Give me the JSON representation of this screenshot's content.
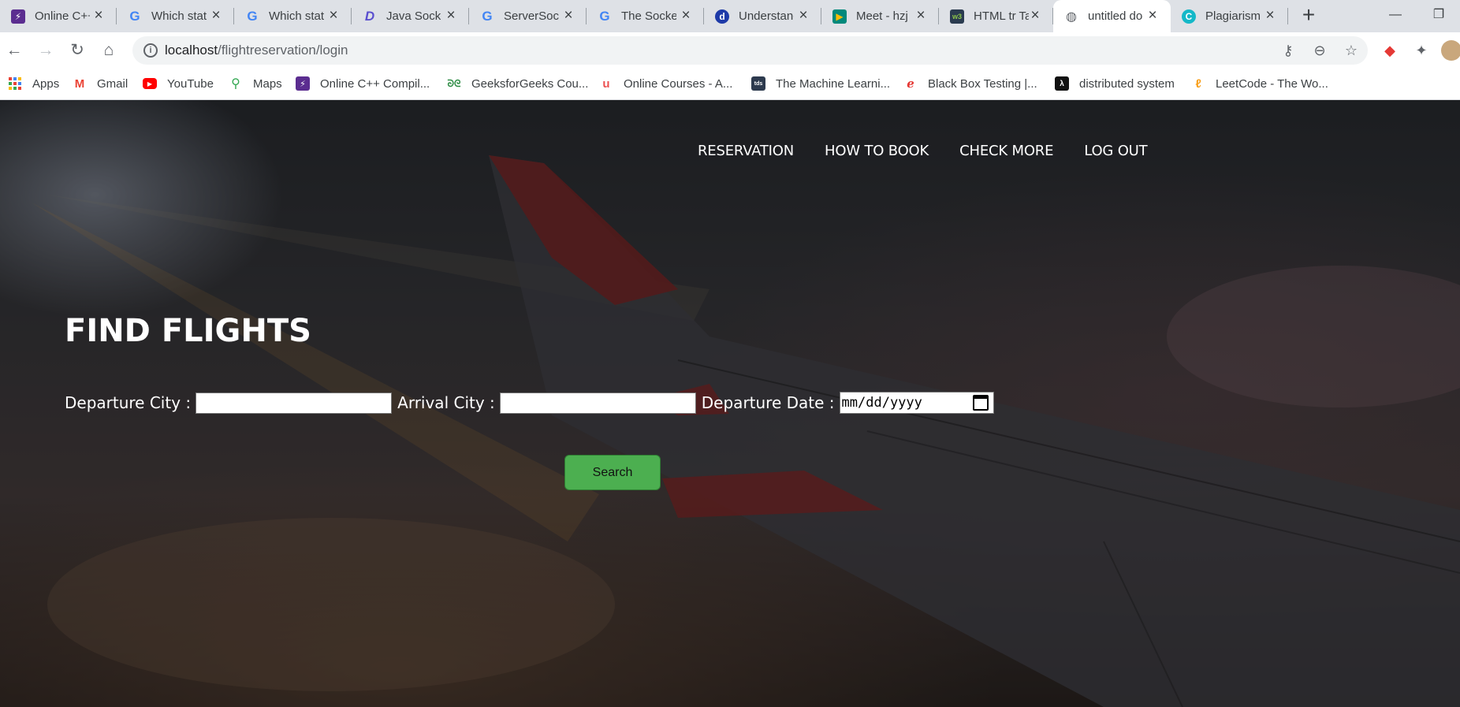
{
  "browser": {
    "tabs": [
      {
        "title": "Online C++",
        "favicon": "lightning-icon",
        "color": "#5b2d90"
      },
      {
        "title": "Which static",
        "favicon": "google-icon",
        "color": "#4285f4"
      },
      {
        "title": "Which static",
        "favicon": "google-icon",
        "color": "#4285f4"
      },
      {
        "title": "Java Socket",
        "favicon": "d-logo-icon",
        "color": "#5a4fcf"
      },
      {
        "title": "ServerSocket",
        "favicon": "google-icon",
        "color": "#4285f4"
      },
      {
        "title": "The Socket",
        "favicon": "google-icon",
        "color": "#4285f4"
      },
      {
        "title": "Understanding",
        "favicon": "d-circle-icon",
        "color": "#1e3aa8"
      },
      {
        "title": "Meet - hzj",
        "favicon": "meet-icon",
        "color": "#00897b"
      },
      {
        "title": "HTML tr Tag",
        "favicon": "w3-icon",
        "color": "#2a3b4f"
      },
      {
        "title": "untitled document",
        "favicon": "globe-icon",
        "color": "#5f6368"
      },
      {
        "title": "Plagiarism",
        "favicon": "c-logo-icon",
        "color": "#14b8c8"
      }
    ],
    "active_tab": 9,
    "url_host": "localhost",
    "url_path": "/flightreservation/login",
    "bookmarks": [
      {
        "label": "Apps",
        "icon": "apps-grid-icon"
      },
      {
        "label": "Gmail",
        "icon": "gmail-icon"
      },
      {
        "label": "YouTube",
        "icon": "youtube-icon"
      },
      {
        "label": "Maps",
        "icon": "maps-pin-icon"
      },
      {
        "label": "Online C++ Compil...",
        "icon": "lightning-icon"
      },
      {
        "label": "GeeksforGeeks Cou...",
        "icon": "gfg-icon"
      },
      {
        "label": "Online Courses - A...",
        "icon": "udemy-icon"
      },
      {
        "label": "The Machine Learni...",
        "icon": "tds-icon"
      },
      {
        "label": "Black Box Testing |...",
        "icon": "guru-icon"
      },
      {
        "label": "distributed system",
        "icon": "lambda-icon"
      },
      {
        "label": "LeetCode - The Wo...",
        "icon": "leetcode-icon"
      }
    ]
  },
  "page": {
    "menu": [
      "RESERVATION",
      "HOW TO BOOK",
      "CHECK MORE",
      "LOG OUT"
    ],
    "title": "FIND FLIGHTS",
    "form": {
      "departure_label": "Departure City :",
      "arrival_label": "Arrival City :",
      "date_label": "Departure Date :",
      "date_placeholder": "mm/dd/yyyy",
      "departure_value": "",
      "arrival_value": ""
    },
    "search_label": "Search"
  },
  "colors": {
    "search_button": "#4caf50",
    "tabstrip": "#dee1e6"
  }
}
